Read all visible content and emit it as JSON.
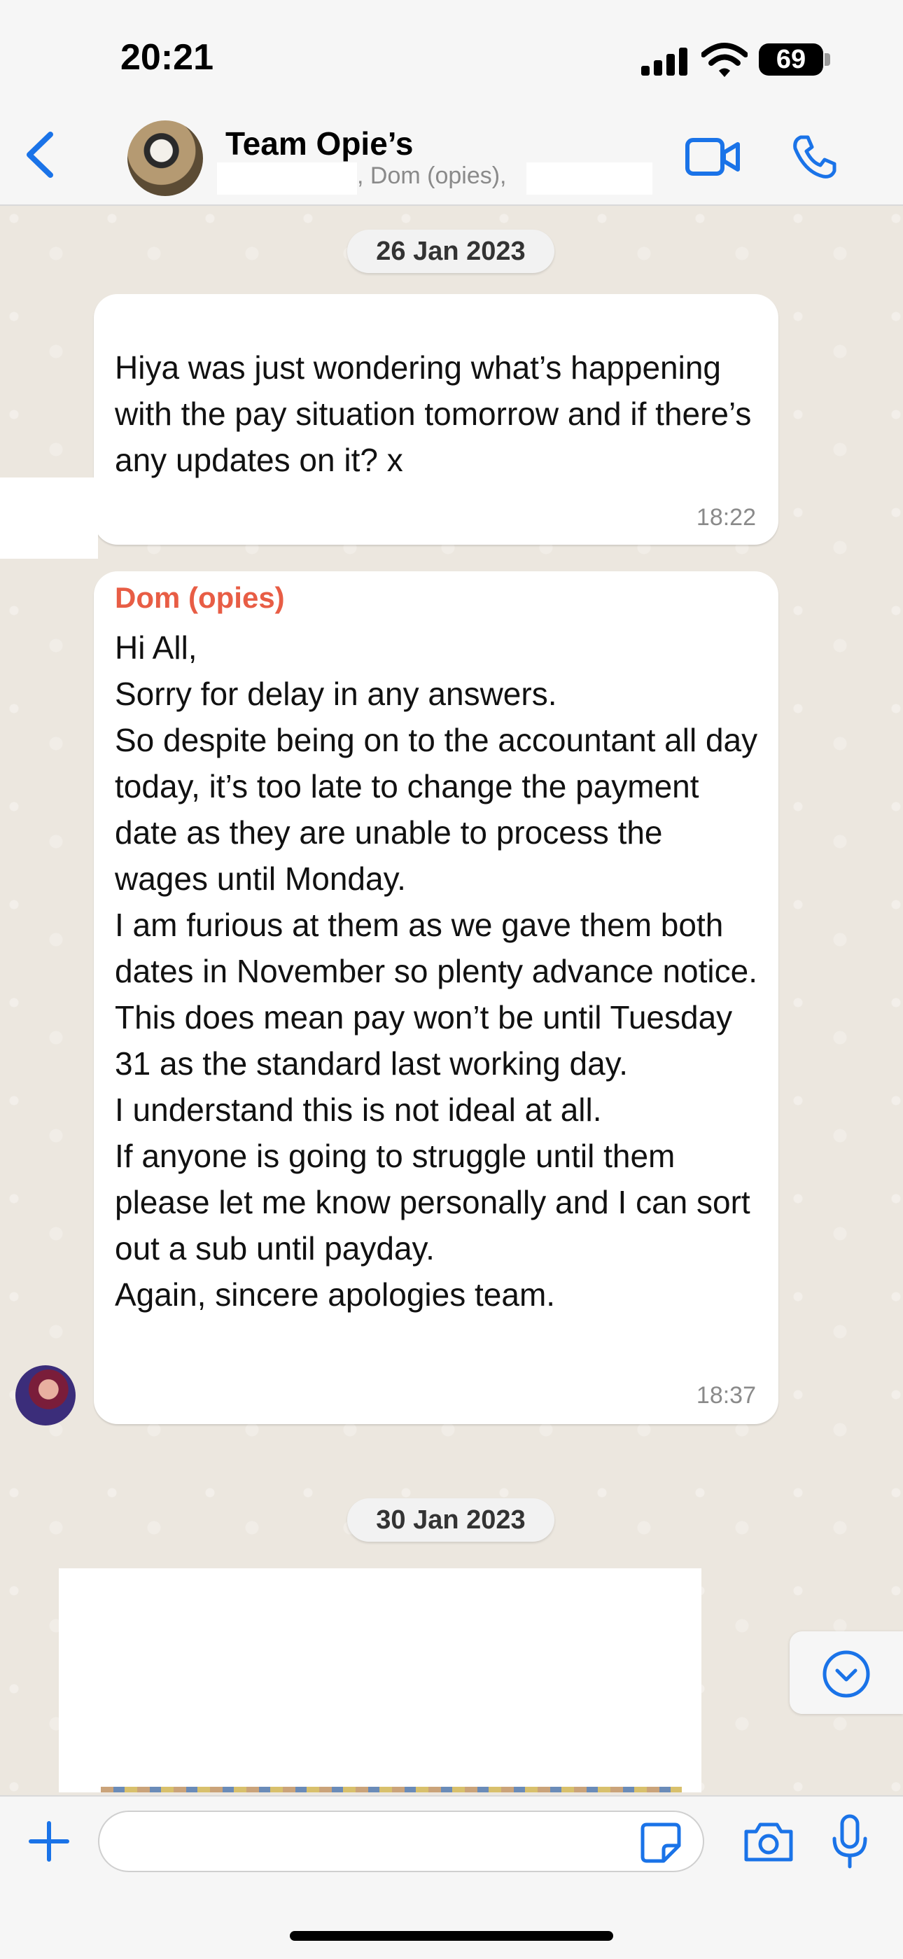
{
  "status_bar": {
    "time": "20:21",
    "battery": "69"
  },
  "header": {
    "title": "Team Opie’s",
    "subtitle": ", Dom (opies),",
    "icons": [
      "back-chevron-icon",
      "video-call-icon",
      "voice-call-icon"
    ]
  },
  "messages": [
    {
      "type": "date",
      "label": "26 Jan 2023"
    },
    {
      "type": "incoming",
      "text": "Hiya was just wondering what’s happening with the pay situation tomorrow and if there’s any updates on it? x",
      "time": "18:22"
    },
    {
      "type": "incoming",
      "sender": "Dom (opies)",
      "text": "Hi All,\nSorry for delay in any answers.\nSo despite being on to the accountant all day today, it’s too late to change the payment date as they are unable to process the wages until Monday.\nI am furious at them as we gave them both dates in November so plenty advance notice.\nThis does mean pay won’t be until Tuesday 31 as the standard last working day.\nI understand this is not ideal at all.\nIf anyone is going to struggle until them please let me know personally and I can sort out a sub until payday.\nAgain, sincere apologies team.",
      "time": "18:37"
    },
    {
      "type": "date",
      "label": "30 Jan 2023"
    }
  ],
  "input": {
    "placeholder": ""
  },
  "colors": {
    "accent": "#1a73e8",
    "sender_name": "#e85d45",
    "chat_background": "#ece7df"
  }
}
